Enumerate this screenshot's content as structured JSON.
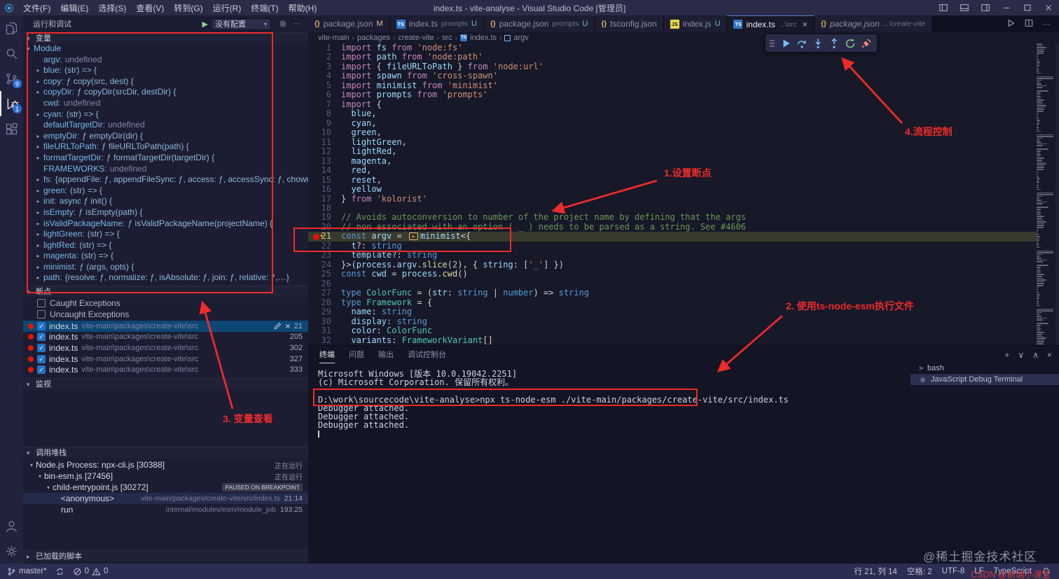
{
  "title_bar": {
    "menus": [
      "文件(F)",
      "编辑(E)",
      "选择(S)",
      "查看(V)",
      "转到(G)",
      "运行(R)",
      "终端(T)",
      "帮助(H)"
    ],
    "window_title": "index.ts - vite-analyse - Visual Studio Code [管理员]"
  },
  "activity_bar": {
    "top": [
      {
        "name": "explorer",
        "active": false
      },
      {
        "name": "search",
        "active": false
      },
      {
        "name": "source-control",
        "badge": "9",
        "active": false
      },
      {
        "name": "run-and-debug",
        "badge": "1",
        "active": true
      },
      {
        "name": "extensions",
        "active": false
      }
    ],
    "bottom": [
      {
        "name": "account"
      },
      {
        "name": "settings"
      }
    ]
  },
  "sidebar": {
    "title": "运行和调试",
    "config_label": "没有配置",
    "variables": {
      "section": "变量",
      "scope": "Module",
      "items": [
        {
          "name": "argv",
          "value": "undefined",
          "kind": "und",
          "expandable": false
        },
        {
          "name": "blue",
          "value": "(str) => {",
          "kind": "fn",
          "expandable": true
        },
        {
          "name": "copy",
          "value": "ƒ copy(src, dest) {",
          "kind": "fn",
          "expandable": true
        },
        {
          "name": "copyDir",
          "value": "ƒ copyDir(srcDir, destDir) {",
          "kind": "fn",
          "expandable": true
        },
        {
          "name": "cwd",
          "value": "undefined",
          "kind": "und",
          "expandable": false
        },
        {
          "name": "cyan",
          "value": "(str) => {",
          "kind": "fn",
          "expandable": true
        },
        {
          "name": "defaultTargetDir",
          "value": "undefined",
          "kind": "und",
          "expandable": false
        },
        {
          "name": "emptyDir",
          "value": "ƒ emptyDir(dir) {",
          "kind": "fn",
          "expandable": true
        },
        {
          "name": "fileURLToPath",
          "value": "ƒ fileURLToPath(path) {",
          "kind": "fn",
          "expandable": true
        },
        {
          "name": "formatTargetDir",
          "value": "ƒ formatTargetDir(targetDir) {",
          "kind": "fn",
          "expandable": true
        },
        {
          "name": "FRAMEWORKS",
          "value": "undefined",
          "kind": "und",
          "expandable": false
        },
        {
          "name": "fs",
          "value": "{appendFile: ƒ, appendFileSync: ƒ, access: ƒ, accessSync: ƒ, chown: ƒ,…}",
          "kind": "obj",
          "expandable": true
        },
        {
          "name": "green",
          "value": "(str) => {",
          "kind": "fn",
          "expandable": true
        },
        {
          "name": "init",
          "value": "async ƒ init() {",
          "kind": "fn",
          "expandable": true
        },
        {
          "name": "isEmpty",
          "value": "ƒ isEmpty(path) {",
          "kind": "fn",
          "expandable": true
        },
        {
          "name": "isValidPackageName",
          "value": "ƒ isValidPackageName(projectName) {",
          "kind": "fn",
          "expandable": true
        },
        {
          "name": "lightGreen",
          "value": "(str) => {",
          "kind": "fn",
          "expandable": true
        },
        {
          "name": "lightRed",
          "value": "(str) => {",
          "kind": "fn",
          "expandable": true
        },
        {
          "name": "magenta",
          "value": "(str) => {",
          "kind": "fn",
          "expandable": true
        },
        {
          "name": "minimist",
          "value": "ƒ (args, opts) {",
          "kind": "fn",
          "expandable": true
        },
        {
          "name": "path",
          "value": "{resolve: ƒ, normalize: ƒ, isAbsolute: ƒ, join: ƒ, relative: ƒ,…}",
          "kind": "obj",
          "expandable": true
        }
      ]
    },
    "breakpoints": {
      "section": "断点",
      "exceptions": [
        {
          "label": "Caught Exceptions",
          "checked": false
        },
        {
          "label": "Uncaught Exceptions",
          "checked": false
        }
      ],
      "items": [
        {
          "file": "index.ts",
          "path": "vite-main\\packages\\create-vite\\src",
          "line": "21",
          "selected": true
        },
        {
          "file": "index.ts",
          "path": "vite-main\\packages\\create-vite\\src",
          "line": "205",
          "selected": false
        },
        {
          "file": "index.ts",
          "path": "vite-main\\packages\\create-vite\\src",
          "line": "302",
          "selected": false
        },
        {
          "file": "index.ts",
          "path": "vite-main\\packages\\create-vite\\src",
          "line": "327",
          "selected": false
        },
        {
          "file": "index.ts",
          "path": "vite-main\\packages\\create-vite\\src",
          "line": "333",
          "selected": false
        }
      ]
    },
    "watch": {
      "section": "监视"
    },
    "call_stack": {
      "section": "调用堆栈",
      "frames": [
        {
          "label": "Node.js Process: npx-cli.js [30388]",
          "badge": "正在运行",
          "indent": 0,
          "expand": true
        },
        {
          "label": "bin-esm.js [27456]",
          "badge": "正在运行",
          "indent": 1,
          "expand": true
        },
        {
          "label": "child-entrypoint.js [30272]",
          "badge": "PAUSED ON BREAKPOINT",
          "indent": 2,
          "expand": true,
          "paused": true
        },
        {
          "label": "<anonymous>",
          "detail": "vite-main/packages/create-vite/src/index.ts",
          "pos": "21:14",
          "indent": 3,
          "current": true
        },
        {
          "label": "run",
          "detail": "internal/modules/esm/module_job",
          "pos": "193:25",
          "indent": 3
        }
      ]
    },
    "loaded_scripts": {
      "section": "已加载的脚本"
    }
  },
  "editor": {
    "tabs": [
      {
        "icon": "json",
        "label": "package.json",
        "badge": "M"
      },
      {
        "icon": "ts",
        "label": "index.ts",
        "sub": "prompts",
        "badge": "U"
      },
      {
        "icon": "json",
        "label": "package.json",
        "sub": "prompts",
        "badge": "U"
      },
      {
        "icon": "json",
        "label": "tsconfig.json"
      },
      {
        "icon": "js",
        "label": "index.js",
        "badge": "U"
      },
      {
        "icon": "ts",
        "label": "index.ts",
        "sub": "...\\src",
        "active": true,
        "close": true
      },
      {
        "icon": "json",
        "label": "package.json",
        "sub": "...\\create-vite",
        "preview": true
      }
    ],
    "breadcrumb": [
      {
        "label": "vite-main"
      },
      {
        "label": "packages"
      },
      {
        "label": "create-vite"
      },
      {
        "label": "src"
      },
      {
        "label": "index.ts",
        "icon": "ts"
      },
      {
        "label": "argv",
        "icon": "symbol"
      }
    ],
    "debug_toolbar": [
      {
        "name": "continue",
        "color": "#75beff"
      },
      {
        "name": "step-over",
        "color": "#75beff"
      },
      {
        "name": "step-into",
        "color": "#75beff"
      },
      {
        "name": "step-out",
        "color": "#75beff"
      },
      {
        "name": "restart",
        "color": "#89d185"
      },
      {
        "name": "disconnect",
        "color": "#f48771"
      }
    ],
    "current_line": 21,
    "breakpoint_lines": [
      21
    ],
    "code_lines": [
      {
        "n": 1,
        "segs": [
          [
            "k",
            "import "
          ],
          [
            "v",
            "fs "
          ],
          [
            "k",
            "from "
          ],
          [
            "s",
            "'node:fs'"
          ]
        ]
      },
      {
        "n": 2,
        "segs": [
          [
            "k",
            "import "
          ],
          [
            "v",
            "path "
          ],
          [
            "k",
            "from "
          ],
          [
            "s",
            "'node:path'"
          ]
        ]
      },
      {
        "n": 3,
        "segs": [
          [
            "k",
            "import "
          ],
          [
            "p",
            "{ "
          ],
          [
            "v",
            "fileURLToPath"
          ],
          [
            "p",
            " } "
          ],
          [
            "k",
            "from "
          ],
          [
            "s",
            "'node:url'"
          ]
        ]
      },
      {
        "n": 4,
        "segs": [
          [
            "k",
            "import "
          ],
          [
            "v",
            "spawn "
          ],
          [
            "k",
            "from "
          ],
          [
            "s",
            "'cross-spawn'"
          ]
        ]
      },
      {
        "n": 5,
        "segs": [
          [
            "k",
            "import "
          ],
          [
            "v",
            "minimist "
          ],
          [
            "k",
            "from "
          ],
          [
            "s",
            "'minimist'"
          ]
        ]
      },
      {
        "n": 6,
        "segs": [
          [
            "k",
            "import "
          ],
          [
            "v",
            "prompts "
          ],
          [
            "k",
            "from "
          ],
          [
            "s",
            "'prompts'"
          ]
        ]
      },
      {
        "n": 7,
        "segs": [
          [
            "k",
            "import "
          ],
          [
            "p",
            "{"
          ]
        ]
      },
      {
        "n": 8,
        "segs": [
          [
            "p",
            "  "
          ],
          [
            "v",
            "blue"
          ],
          [
            "p",
            ","
          ]
        ]
      },
      {
        "n": 9,
        "segs": [
          [
            "p",
            "  "
          ],
          [
            "v",
            "cyan"
          ],
          [
            "p",
            ","
          ]
        ]
      },
      {
        "n": 10,
        "segs": [
          [
            "p",
            "  "
          ],
          [
            "v",
            "green"
          ],
          [
            "p",
            ","
          ]
        ]
      },
      {
        "n": 11,
        "segs": [
          [
            "p",
            "  "
          ],
          [
            "v",
            "lightGreen"
          ],
          [
            "p",
            ","
          ]
        ]
      },
      {
        "n": 12,
        "segs": [
          [
            "p",
            "  "
          ],
          [
            "v",
            "lightRed"
          ],
          [
            "p",
            ","
          ]
        ]
      },
      {
        "n": 13,
        "segs": [
          [
            "p",
            "  "
          ],
          [
            "v",
            "magenta"
          ],
          [
            "p",
            ","
          ]
        ]
      },
      {
        "n": 14,
        "segs": [
          [
            "p",
            "  "
          ],
          [
            "v",
            "red"
          ],
          [
            "p",
            ","
          ]
        ]
      },
      {
        "n": 15,
        "segs": [
          [
            "p",
            "  "
          ],
          [
            "v",
            "reset"
          ],
          [
            "p",
            ","
          ]
        ]
      },
      {
        "n": 16,
        "segs": [
          [
            "p",
            "  "
          ],
          [
            "v",
            "yellow"
          ]
        ]
      },
      {
        "n": 17,
        "segs": [
          [
            "p",
            "} "
          ],
          [
            "k",
            "from "
          ],
          [
            "s",
            "'kolorist'"
          ]
        ]
      },
      {
        "n": 18,
        "segs": []
      },
      {
        "n": 19,
        "segs": [
          [
            "c",
            "// Avoids autoconversion to number of the project name by defining that the args"
          ]
        ]
      },
      {
        "n": 20,
        "segs": [
          [
            "c",
            "// non associated with an option ( _ ) needs to be parsed as a string. See #4606"
          ]
        ]
      },
      {
        "n": 21,
        "segs": [
          [
            "d",
            "const "
          ],
          [
            "v",
            "argv "
          ],
          [
            "p",
            "= "
          ],
          [
            "dbg",
            "▸"
          ],
          [
            "v",
            "minimist"
          ],
          [
            "p",
            "<{"
          ]
        ]
      },
      {
        "n": 22,
        "segs": [
          [
            "p",
            "  "
          ],
          [
            "v",
            "t"
          ],
          [
            "p",
            "?: "
          ],
          [
            "d",
            "string"
          ]
        ]
      },
      {
        "n": 23,
        "segs": [
          [
            "p",
            "  "
          ],
          [
            "v",
            "template"
          ],
          [
            "p",
            "?: "
          ],
          [
            "d",
            "string"
          ]
        ]
      },
      {
        "n": 24,
        "segs": [
          [
            "p",
            "}>("
          ],
          [
            "v",
            "process"
          ],
          [
            "p",
            "."
          ],
          [
            "v",
            "argv"
          ],
          [
            "p",
            "."
          ],
          [
            "f",
            "slice"
          ],
          [
            "p",
            "("
          ],
          [
            "num",
            "2"
          ],
          [
            "p",
            "), { "
          ],
          [
            "v",
            "string"
          ],
          [
            "p",
            ": ["
          ],
          [
            "s",
            "'_'"
          ],
          [
            "p",
            "] })"
          ]
        ]
      },
      {
        "n": 25,
        "segs": [
          [
            "d",
            "const "
          ],
          [
            "v",
            "cwd "
          ],
          [
            "p",
            "= "
          ],
          [
            "v",
            "process"
          ],
          [
            "p",
            "."
          ],
          [
            "f",
            "cwd"
          ],
          [
            "p",
            "()"
          ]
        ]
      },
      {
        "n": 26,
        "segs": []
      },
      {
        "n": 27,
        "segs": [
          [
            "d",
            "type "
          ],
          [
            "t",
            "ColorFunc"
          ],
          [
            "p",
            " = ("
          ],
          [
            "v",
            "str"
          ],
          [
            "p",
            ": "
          ],
          [
            "d",
            "string"
          ],
          [
            "p",
            " | "
          ],
          [
            "d",
            "number"
          ],
          [
            "p",
            ") => "
          ],
          [
            "d",
            "string"
          ]
        ]
      },
      {
        "n": 28,
        "segs": [
          [
            "d",
            "type "
          ],
          [
            "t",
            "Framework"
          ],
          [
            "p",
            " = {"
          ]
        ]
      },
      {
        "n": 29,
        "segs": [
          [
            "p",
            "  "
          ],
          [
            "v",
            "name"
          ],
          [
            "p",
            ": "
          ],
          [
            "d",
            "string"
          ]
        ]
      },
      {
        "n": 30,
        "segs": [
          [
            "p",
            "  "
          ],
          [
            "v",
            "display"
          ],
          [
            "p",
            ": "
          ],
          [
            "d",
            "string"
          ]
        ]
      },
      {
        "n": 31,
        "segs": [
          [
            "p",
            "  "
          ],
          [
            "v",
            "color"
          ],
          [
            "p",
            ": "
          ],
          [
            "t",
            "ColorFunc"
          ]
        ]
      },
      {
        "n": 32,
        "segs": [
          [
            "p",
            "  "
          ],
          [
            "v",
            "variants"
          ],
          [
            "p",
            ": "
          ],
          [
            "t",
            "FrameworkVariant"
          ],
          [
            "p",
            "[]"
          ]
        ]
      }
    ]
  },
  "panel": {
    "tabs": [
      {
        "label": "终端",
        "active": true
      },
      {
        "label": "问题"
      },
      {
        "label": "输出"
      },
      {
        "label": "调试控制台"
      }
    ],
    "terminal_lines": [
      {
        "text": "Microsoft Windows [版本 10.0.19042.2251]"
      },
      {
        "text": "(c) Microsoft Corporation. 保留所有权利。"
      },
      {
        "text": ""
      },
      {
        "text": "D:\\work\\sourcecode\\vite-analyse>npx ts-node-esm ./vite-main/packages/create-vite/src/index.ts",
        "command": true
      },
      {
        "text": "Debugger attached."
      },
      {
        "text": "Debugger attached."
      },
      {
        "text": "Debugger attached."
      }
    ],
    "terminal_list": [
      {
        "label": "bash",
        "icon": "terminal"
      },
      {
        "label": "JavaScript Debug Terminal",
        "icon": "debug",
        "selected": true
      }
    ]
  },
  "status_bar": {
    "branch": "master*",
    "errors": "0",
    "warnings": "0",
    "line_col": "行 21, 列 14",
    "spaces": "空格: 2",
    "encoding": "UTF-8",
    "eol": "LF",
    "language": "TypeScript"
  },
  "annotations": {
    "note_breakpoint": "1.设置断点",
    "note_flow": "4.流程控制",
    "note_exec": "2. 使用ts-node-esm执行文件",
    "note_vars": "3. 变量查看",
    "watermark_juejin": "@稀土掘金技术社区",
    "watermark_csdn": "CSDN @前端小课堂"
  }
}
